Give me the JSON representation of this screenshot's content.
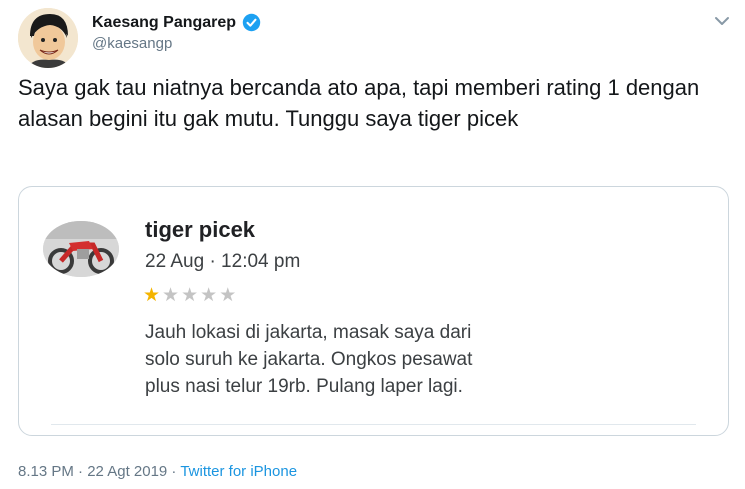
{
  "author": {
    "name": "Kaesang Pangarep",
    "handle": "@kaesangp",
    "verified": true
  },
  "tweet": {
    "text": "Saya gak tau niatnya bercanda ato apa, tapi memberi rating 1 dengan alasan begini itu gak mutu. Tunggu saya tiger picek"
  },
  "review_card": {
    "reviewer_name": "tiger picek",
    "date": "22 Aug · 12:04 pm",
    "rating": 1,
    "max_rating": 5,
    "text": "Jauh lokasi di jakarta, masak saya dari\nsolo suruh ke jakarta. Ongkos pesawat\nplus nasi telur  19rb. Pulang laper lagi."
  },
  "footer": {
    "timestamp": "8.13 PM · 22 Agt 2019 · ",
    "source": "Twitter for iPhone"
  },
  "colors": {
    "star_filled": "#f4b400",
    "star_empty": "#c4c4c4",
    "verified": "#1da1f2",
    "link": "#1b95e0"
  }
}
